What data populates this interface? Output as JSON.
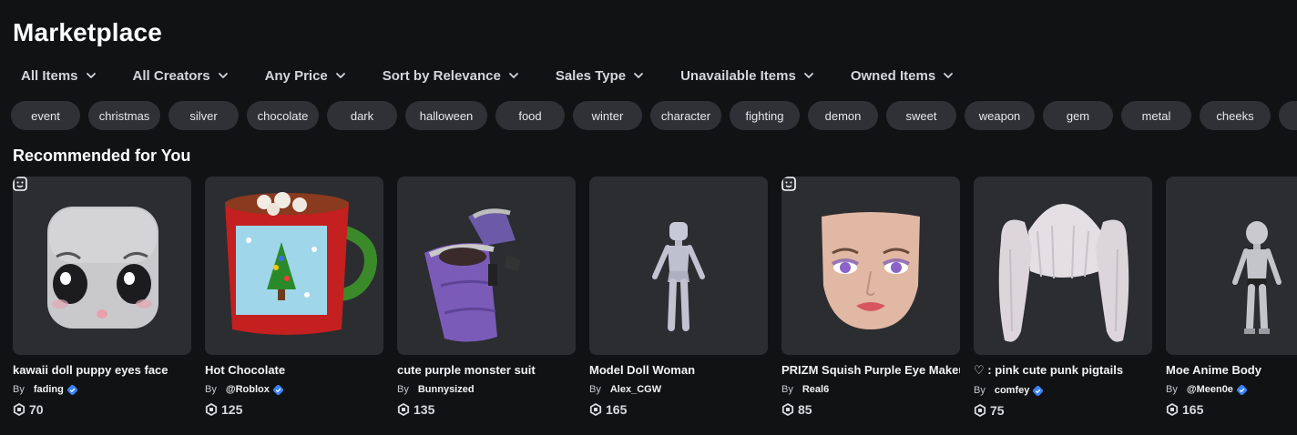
{
  "page": {
    "title": "Marketplace"
  },
  "filters": [
    {
      "label": "All Items"
    },
    {
      "label": "All Creators"
    },
    {
      "label": "Any Price"
    },
    {
      "label": "Sort by Relevance"
    },
    {
      "label": "Sales Type"
    },
    {
      "label": "Unavailable Items"
    },
    {
      "label": "Owned Items"
    }
  ],
  "chips": [
    "event",
    "christmas",
    "silver",
    "chocolate",
    "dark",
    "halloween",
    "food",
    "winter",
    "character",
    "fighting",
    "demon",
    "sweet",
    "weapon",
    "gem",
    "metal",
    "cheeks",
    "c"
  ],
  "section": {
    "title": "Recommended for You"
  },
  "items": [
    {
      "name": "kawaii doll puppy eyes face",
      "by": "By",
      "creator": "fading",
      "verified": true,
      "price": "70",
      "face_badge": true
    },
    {
      "name": "Hot Chocolate",
      "by": "By",
      "creator": "@Roblox",
      "verified": true,
      "price": "125",
      "face_badge": false
    },
    {
      "name": "cute purple monster suit",
      "by": "By",
      "creator": "Bunnysized",
      "verified": false,
      "price": "135",
      "face_badge": false
    },
    {
      "name": "Model Doll Woman",
      "by": "By",
      "creator": "Alex_CGW",
      "verified": false,
      "price": "165",
      "face_badge": false
    },
    {
      "name": "PRIZM Squish Purple Eye Makeup",
      "by": "By",
      "creator": "Real6",
      "verified": false,
      "price": "85",
      "face_badge": true
    },
    {
      "name": "♡ : pink cute punk pigtails",
      "by": "By",
      "creator": "comfey",
      "verified": true,
      "price": "75",
      "face_badge": false
    },
    {
      "name": "Moe Anime Body",
      "by": "By",
      "creator": "@Meen0e",
      "verified": true,
      "price": "165",
      "face_badge": false
    }
  ],
  "icons": {
    "chevron": "chevron-down-icon",
    "currency": "robux-icon",
    "verified": "verified-badge-icon",
    "face": "dynamic-face-icon"
  },
  "colors": {
    "background": "#111214",
    "card": "#2b2d31",
    "chip": "#2f3136",
    "verified": "#3b82f6"
  }
}
